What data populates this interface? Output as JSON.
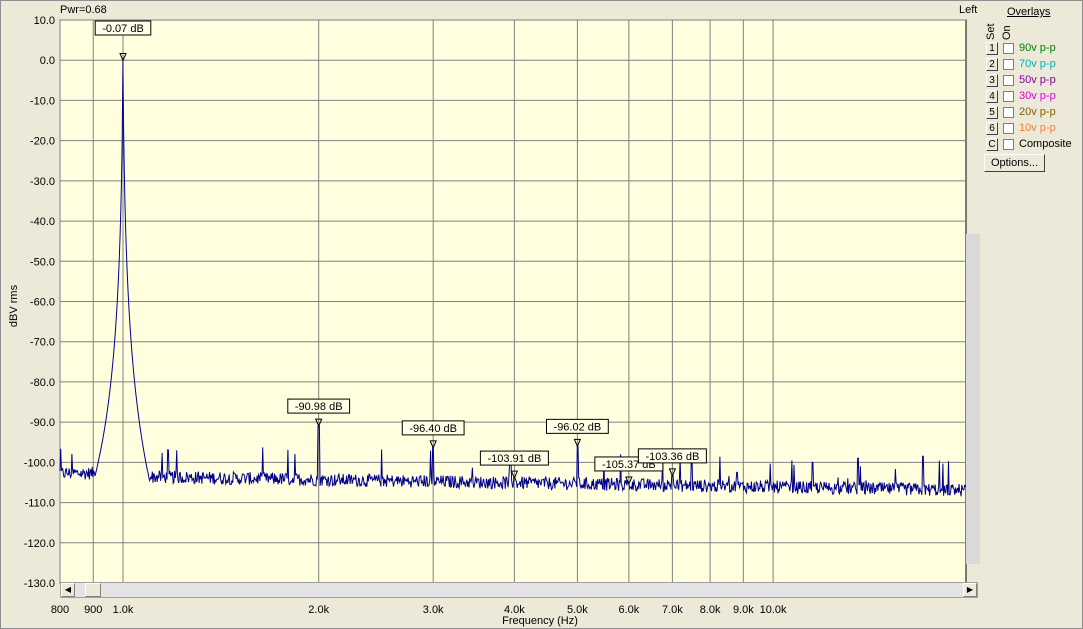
{
  "header": {
    "power": "Pwr=0.68",
    "channel": "Left"
  },
  "colors": {
    "plot_bg": "#ffffe0",
    "trace": "#00008c",
    "grid": "#808080"
  },
  "chart_data": {
    "type": "line",
    "xscale": "log",
    "xlim": [
      800,
      20000
    ],
    "ylim": [
      -130,
      10
    ],
    "xlabel": "Frequency (Hz)",
    "ylabel": "dBV rms",
    "grid": true,
    "y_ticks": [
      "10.0",
      "0.0",
      "-10.0",
      "-20.0",
      "-30.0",
      "-40.0",
      "-50.0",
      "-60.0",
      "-70.0",
      "-80.0",
      "-90.0",
      "-100.0",
      "-110.0",
      "-120.0",
      "-130.0"
    ],
    "x_ticks": [
      {
        "value": 800,
        "label": "800"
      },
      {
        "value": 900,
        "label": "900"
      },
      {
        "value": 1000,
        "label": "1.0k"
      },
      {
        "value": 2000,
        "label": "2.0k"
      },
      {
        "value": 3000,
        "label": "3.0k"
      },
      {
        "value": 4000,
        "label": "4.0k"
      },
      {
        "value": 5000,
        "label": "5.0k"
      },
      {
        "value": 6000,
        "label": "6.0k"
      },
      {
        "value": 7000,
        "label": "7.0k"
      },
      {
        "value": 8000,
        "label": "8.0k"
      },
      {
        "value": 9000,
        "label": "9.0k"
      },
      {
        "value": 10000,
        "label": "10.0k"
      }
    ],
    "noise_floor_db": -103.5,
    "fundamental": {
      "x": 1000,
      "y": -0.07
    },
    "markers": [
      {
        "x": 1000,
        "y": -0.07,
        "label": "-0.07 dB"
      },
      {
        "x": 2000,
        "y": -90.98,
        "label": "-90.98 dB"
      },
      {
        "x": 3000,
        "y": -96.4,
        "label": "-96.40 dB"
      },
      {
        "x": 4000,
        "y": -103.91,
        "label": "-103.91 dB"
      },
      {
        "x": 5000,
        "y": -96.02,
        "label": "-96.02 dB"
      },
      {
        "x": 6000,
        "y": -105.37,
        "label": "-105.37 dB"
      },
      {
        "x": 7000,
        "y": -103.36,
        "label": "-103.36 dB"
      }
    ],
    "spurs": [
      {
        "x": 7500,
        "y": -98.5
      },
      {
        "x": 8800,
        "y": -102.5
      },
      {
        "x": 11500,
        "y": -100.0
      },
      {
        "x": 13500,
        "y": -99.0
      },
      {
        "x": 17000,
        "y": -98.5
      }
    ]
  },
  "overlays": {
    "title": "Overlays",
    "set_label": "Set",
    "on_label": "On",
    "items": [
      {
        "key": "1",
        "label": "90v p-p",
        "color": "#008000"
      },
      {
        "key": "2",
        "label": "70v p-p",
        "color": "#00b0b0"
      },
      {
        "key": "3",
        "label": "50v p-p",
        "color": "#8000a0"
      },
      {
        "key": "4",
        "label": "30v p-p",
        "color": "#e000e0"
      },
      {
        "key": "5",
        "label": "20v p-p",
        "color": "#806000"
      },
      {
        "key": "6",
        "label": "10v p-p",
        "color": "#f08040"
      },
      {
        "key": "C",
        "label": "Composite",
        "color": "#000000"
      }
    ],
    "options_label": "Options..."
  }
}
